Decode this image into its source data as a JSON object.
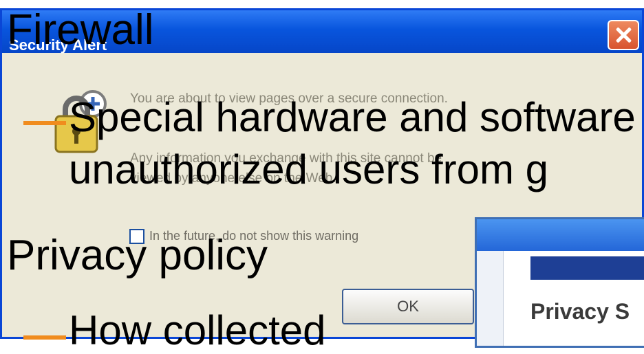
{
  "dialog": {
    "title": "Security Alert",
    "message_line1": "You are about to view pages over a secure connection.",
    "message_line2": "Any information you exchange with this site cannot be",
    "message_line3": "viewed by anyone else on the Web.",
    "checkbox_label": "In the future, do not show this warning",
    "ok_label": "OK"
  },
  "privacy_window": {
    "heading": "Privacy S"
  },
  "slide": {
    "bullet1": "Firewall",
    "bullet1_sub": "Special hardware and software",
    "bullet1_sub_line2": "unauthorized users from g",
    "bullet2": "Privacy policy",
    "bullet2_sub": "How collected"
  },
  "colors": {
    "accent_dash": "#f08c1e",
    "title_bar": "#0a46d6"
  },
  "icons": [
    "close-icon",
    "lock-icon",
    "checkbox-icon"
  ]
}
